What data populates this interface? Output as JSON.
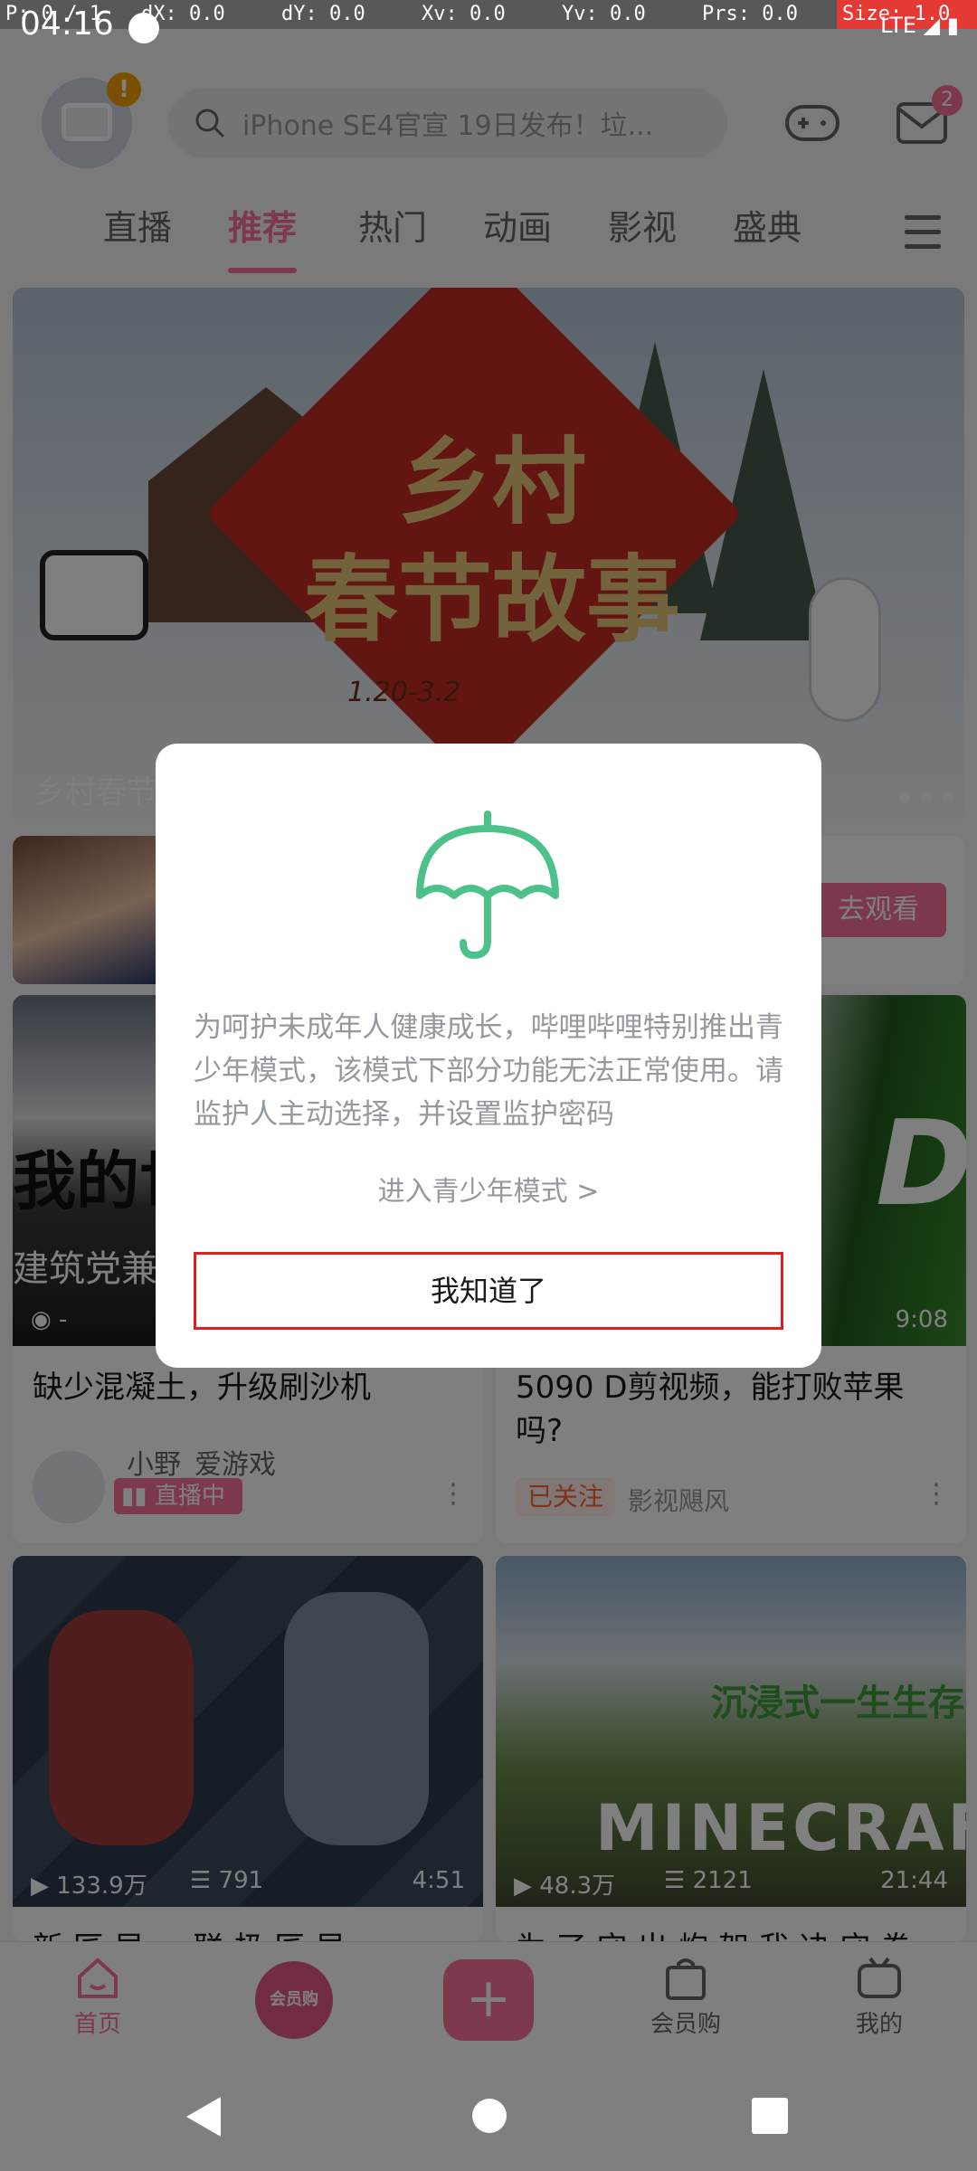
{
  "debug_bar": {
    "pointer": "P: 0 / 1",
    "dx": "dX: 0.0",
    "dy": "dY: 0.0",
    "xv": "Xv: 0.0",
    "yv": "Yv: 0.0",
    "prs": "Prs: 0.0",
    "size": "Size: 1.0"
  },
  "status_bar": {
    "time": "04:16",
    "network": "LTE"
  },
  "header": {
    "search_placeholder": "iPhone SE4官宣 19日发布！垃...",
    "mail_badge": "2",
    "avatar_warning": "!"
  },
  "tabs": [
    {
      "label": "直播"
    },
    {
      "label": "推荐"
    },
    {
      "label": "热门"
    },
    {
      "label": "动画"
    },
    {
      "label": "影视"
    },
    {
      "label": "盛典"
    }
  ],
  "banner": {
    "art_title_line1": "乡村",
    "art_title_line2": "春节故事",
    "art_date": "1.20-3.2",
    "caption": "乡村春节"
  },
  "live_strip": {
    "button_label": "去观看"
  },
  "cards": [
    {
      "cover_text": "我的世",
      "cover_subtext": "建筑党兼",
      "views": "-",
      "title": "缺少混凝土，升级刷沙机",
      "author": "小野_爱游戏",
      "live_tag": "直播中"
    },
    {
      "cover_text": "D",
      "duration": "9:08",
      "title": "5090 D剪视频，能打败苹果吗?",
      "follow_tag": "已关注",
      "author": "影视飓风"
    },
    {
      "views": "133.9万",
      "danmaku": "791",
      "duration": "4:51",
      "title": "新 匠 早   ... 联 极 匠 早"
    },
    {
      "cover_text": "沉浸式一生生存",
      "cover_logo": "MINECRAFT",
      "views": "48.3万",
      "danmaku": "2121",
      "duration": "21:44",
      "title": "为 了 守 出 炮 架   我 决 守 卷 会"
    }
  ],
  "bottom_nav": {
    "home": "首页",
    "vip_badge": "会员购",
    "vip_shop": "会员购",
    "mine": "我的",
    "plus": "+"
  },
  "dialog": {
    "message": "为呵护未成年人健康成长，哔哩哔哩特别推出青少年模式，该模式下部分功能无法正常使用。请监护人主动选择，并设置监护密码",
    "link": "进入青少年模式 >",
    "confirm_button": "我知道了"
  },
  "colors": {
    "accent": "#fb7299",
    "dialog_icon": "#4cc28a",
    "focus_border": "#e02020"
  }
}
